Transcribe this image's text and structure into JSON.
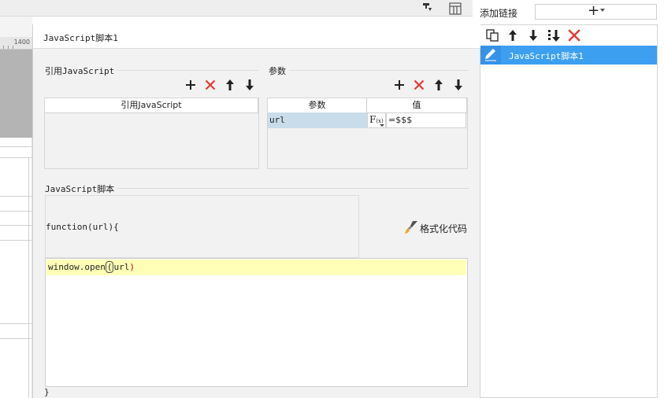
{
  "background": {
    "ruler_label": "1400"
  },
  "top_right": {
    "add_link_label": "添加链接",
    "add_link_button": "+"
  },
  "link_panel": {
    "toolbar_icons": [
      "copy-icon",
      "arrow-up-icon",
      "arrow-down-icon",
      "move-bottom-icon",
      "delete-icon"
    ],
    "items": [
      {
        "label": "JavaScript脚本1",
        "selected": true,
        "icon": "pencil-icon"
      }
    ],
    "selected_color": "#3d9ff0"
  },
  "dialog": {
    "title": "JavaScript脚本1",
    "ref_section": {
      "label": "引用JavaScript",
      "column_header": "引用JavaScript",
      "rows": []
    },
    "param_section": {
      "label": "参数",
      "columns": [
        "参数",
        "值"
      ],
      "rows": [
        {
          "name": "url",
          "fx": "F(x)",
          "value": "=$$$"
        }
      ]
    },
    "script_section": {
      "label": "JavaScript脚本",
      "header_code": "function(url){",
      "format_button": "格式化代码",
      "code_line": {
        "prefix": "window.open",
        "paren_open": "(",
        "arg": "url",
        "paren_close": ")"
      },
      "footer_code": "}"
    },
    "toolbar_colors": {
      "add": "#222222",
      "delete": "#e53935"
    }
  }
}
